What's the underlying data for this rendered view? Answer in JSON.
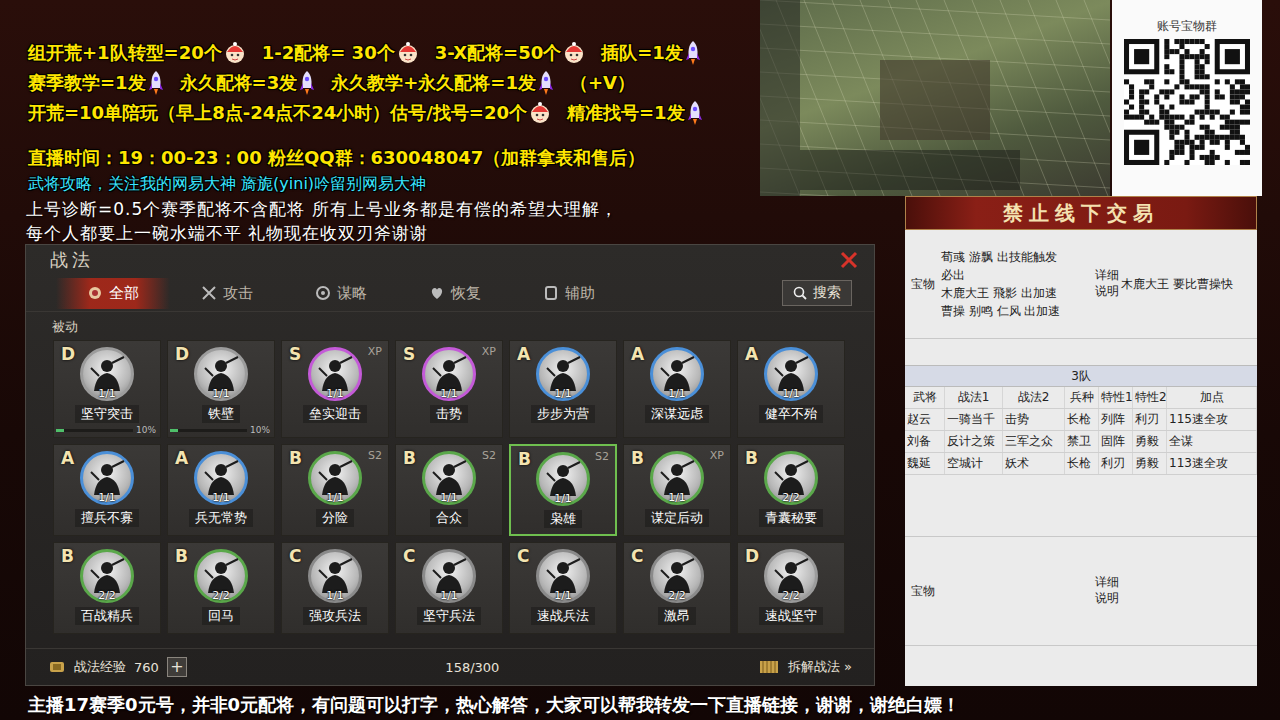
{
  "header_lines": [
    {
      "color": "#ffe600",
      "segments": [
        {
          "text": "组开荒+1队转型=20个",
          "kind": "face"
        },
        {
          "text": "1-2配将= 30个",
          "kind": "face"
        },
        {
          "text": "3-X配将=50个",
          "kind": "face"
        },
        {
          "text": "插队=1发",
          "kind": "rocket"
        }
      ]
    },
    {
      "color": "#ffe600",
      "segments": [
        {
          "text": "赛季教学=1发",
          "kind": "rocket"
        },
        {
          "text": "永久配将=3发",
          "kind": "rocket"
        },
        {
          "text": "永久教学+永久配将=1发",
          "kind": "rocket"
        },
        {
          "text": "（+V）",
          "kind": "plain"
        }
      ]
    },
    {
      "color": "#ffe600",
      "segments": [
        {
          "text": "开荒=10单陪玩（早上8点-24点不24小时）估号/找号=20个",
          "kind": "face"
        },
        {
          "text": "精准找号=1发",
          "kind": "rocket"
        }
      ]
    },
    {
      "color": "#ffe600",
      "segments": [
        {
          "text": "直播时间：19：00-23：00   粉丝QQ群：630048047（加群拿表和售后）",
          "kind": "plain"
        }
      ]
    },
    {
      "color": "#39e6ff",
      "segments": [
        {
          "text": "武将攻略，关注我的网易大神 旖旎(yini)吟留别网易大神",
          "kind": "plain"
        }
      ]
    }
  ],
  "qr": {
    "label": "账号宝物群"
  },
  "notice_lines": [
    "上号诊断=0.5个赛季配将不含配将 所有上号业务都是有偿的希望大理解，",
    "每个人都要上一碗水端不平 礼物现在收双刃斧谢谢"
  ],
  "dialog": {
    "title": "战法",
    "tabs": [
      {
        "label": "全部",
        "selected": true
      },
      {
        "label": "攻击",
        "selected": false
      },
      {
        "label": "谋略",
        "selected": false
      },
      {
        "label": "恢复",
        "selected": false
      },
      {
        "label": "辅助",
        "selected": false
      }
    ],
    "search": "搜索",
    "section": "被动",
    "cards": [
      {
        "grade": "D",
        "name": "坚守突击",
        "count": "1/1",
        "color": "#9c9c9c",
        "level": 0.1,
        "percent": "10%",
        "selected": false
      },
      {
        "grade": "D",
        "name": "铁壁",
        "count": "1/1",
        "color": "#9c9c9c",
        "level": 0.1,
        "percent": "10%",
        "selected": false
      },
      {
        "grade": "S",
        "name": "垒实迎击",
        "count": "1/1",
        "tag": "XP",
        "color": "#c45ad8",
        "selected": false
      },
      {
        "grade": "S",
        "name": "击势",
        "count": "1/1",
        "tag": "XP",
        "color": "#c45ad8",
        "selected": false
      },
      {
        "grade": "A",
        "name": "步步为营",
        "count": "1/1",
        "color": "#4a8fd8",
        "selected": false
      },
      {
        "grade": "A",
        "name": "深谋远虑",
        "count": "1/1",
        "color": "#4a8fd8",
        "selected": false
      },
      {
        "grade": "A",
        "name": "健卒不殆",
        "count": "1/1",
        "color": "#4a8fd8",
        "selected": false
      },
      {
        "grade": "A",
        "name": "擅兵不寡",
        "count": "1/1",
        "color": "#4a8fd8",
        "selected": false
      },
      {
        "grade": "A",
        "name": "兵无常势",
        "count": "1/1",
        "color": "#4a8fd8",
        "selected": false
      },
      {
        "grade": "B",
        "name": "分险",
        "count": "1/1",
        "tag": "S2",
        "color": "#5aa84a",
        "selected": false
      },
      {
        "grade": "B",
        "name": "合众",
        "count": "1/1",
        "tag": "S2",
        "color": "#5aa84a",
        "selected": false
      },
      {
        "grade": "B",
        "name": "枭雄",
        "count": "1/1",
        "tag": "S2",
        "color": "#5aa84a",
        "selected": true
      },
      {
        "grade": "B",
        "name": "谋定后动",
        "count": "1/1",
        "tag": "XP",
        "color": "#5aa84a",
        "selected": false
      },
      {
        "grade": "B",
        "name": "青囊秘要",
        "count": "2/2",
        "color": "#5aa84a",
        "selected": false
      },
      {
        "grade": "B",
        "name": "百战精兵",
        "count": "2/2",
        "color": "#5aa84a",
        "selected": false
      },
      {
        "grade": "B",
        "name": "回马",
        "count": "2/2",
        "color": "#5aa84a",
        "selected": false
      },
      {
        "grade": "C",
        "name": "强攻兵法",
        "count": "1/1",
        "color": "#8a8a8a",
        "selected": false
      },
      {
        "grade": "C",
        "name": "坚守兵法",
        "count": "1/1",
        "color": "#8a8a8a",
        "selected": false
      },
      {
        "grade": "C",
        "name": "速战兵法",
        "count": "1/1",
        "color": "#8a8a8a",
        "selected": false
      },
      {
        "grade": "C",
        "name": "激昂",
        "count": "2/2",
        "color": "#8a8a8a",
        "selected": false
      },
      {
        "grade": "D",
        "name": "速战坚守",
        "count": "2/2",
        "color": "#9c9c9c",
        "selected": false
      }
    ],
    "exp_label": "战法经验",
    "exp_value": "760",
    "add": "+",
    "capacity": "158/300",
    "decompose": "拆解战法 »"
  },
  "side_panel": {
    "banner": "禁止线下交易",
    "treasure_top": {
      "label": "宝物",
      "lines": [
        "荀彧 游飘 出技能触发",
        "必出",
        "木鹿大王 飛影 出加速",
        "曹操 别鸣 仁风 出加速"
      ],
      "detail_label": "详细说明",
      "detail": "木鹿大王 要比曹操快"
    },
    "team": "3队",
    "columns": [
      "武将",
      "战法1",
      "战法2",
      "兵种",
      "特性1",
      "特性2",
      "加点"
    ],
    "rows": [
      [
        "赵云",
        "一骑当千",
        "击势",
        "长枪",
        "列阵",
        "利刃",
        "115速全攻"
      ],
      [
        "刘备",
        "反计之策",
        "三军之众",
        "禁卫",
        "固阵",
        "勇毅",
        "全谋"
      ],
      [
        "魏延",
        "空城计",
        "妖术",
        "长枪",
        "利刃",
        "勇毅",
        "113速全攻"
      ]
    ],
    "treasure_bottom": {
      "label": "宝物",
      "detail_label": "详细说明"
    }
  },
  "ticker": "主播17赛季0元号，并非0元配将，有问题可以打字，热心解答，大家可以帮我转发一下直播链接，谢谢，谢绝白嫖！"
}
